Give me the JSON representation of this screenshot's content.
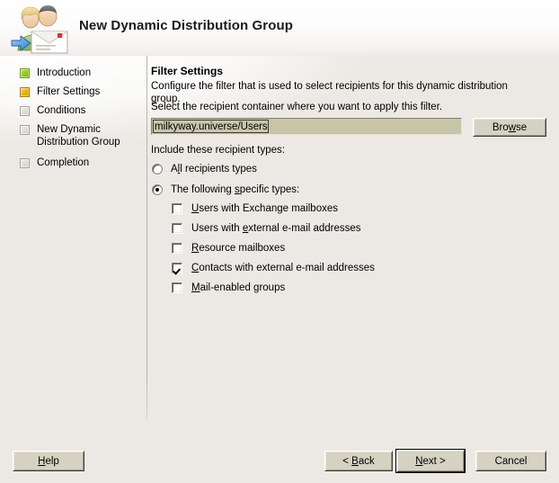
{
  "window": {
    "title": "New Dynamic Distribution Group",
    "icon": "users-envelope-icon"
  },
  "sidebar": {
    "items": [
      {
        "label": "Introduction",
        "state": "done"
      },
      {
        "label": "Filter Settings",
        "state": "current"
      },
      {
        "label": "Conditions",
        "state": "pending"
      },
      {
        "label": "New Dynamic Distribution Group",
        "state": "pending"
      },
      {
        "label": "Completion",
        "state": "pending"
      }
    ]
  },
  "main": {
    "heading": "Filter Settings",
    "description": "Configure the filter that is used to select recipients for this dynamic distribution group.",
    "instruction": "Select the recipient container where you want to apply this filter.",
    "container": {
      "value": "milkyway.universe/Users",
      "browse_label": "Browse",
      "browse_accel": "w"
    },
    "include_label": "Include these recipient types:",
    "radios": [
      {
        "label_pre": "A",
        "label_accel": "l",
        "label_post": "l recipients types",
        "checked": false
      },
      {
        "label_pre": "The following ",
        "label_accel": "s",
        "label_post": "pecific types:",
        "checked": true
      }
    ],
    "checkboxes": [
      {
        "label_pre": "",
        "label_accel": "U",
        "label_post": "sers with Exchange mailboxes",
        "checked": false
      },
      {
        "label_pre": "Users with ",
        "label_accel": "e",
        "label_post": "xternal e-mail addresses",
        "checked": false
      },
      {
        "label_pre": "",
        "label_accel": "R",
        "label_post": "esource mailboxes",
        "checked": false
      },
      {
        "label_pre": "",
        "label_accel": "C",
        "label_post": "ontacts with external e-mail addresses",
        "checked": true
      },
      {
        "label_pre": "",
        "label_accel": "M",
        "label_post": "ail-enabled groups",
        "checked": false
      }
    ]
  },
  "footer": {
    "help": {
      "pre": "",
      "accel": "H",
      "post": "elp"
    },
    "back": {
      "pre": "< ",
      "accel": "B",
      "post": "ack"
    },
    "next": {
      "pre": "",
      "accel": "N",
      "post": "ext >"
    },
    "cancel": {
      "pre": "Cancel",
      "accel": "",
      "post": ""
    }
  },
  "colors": {
    "body_bg": "#ece9e4",
    "header_bg": "#ffffff",
    "done": "#8fd318",
    "current": "#f0b412",
    "pending": "#dedcd8",
    "input_bg": "#c8c4a8",
    "button_face": "#d6d2c2"
  }
}
